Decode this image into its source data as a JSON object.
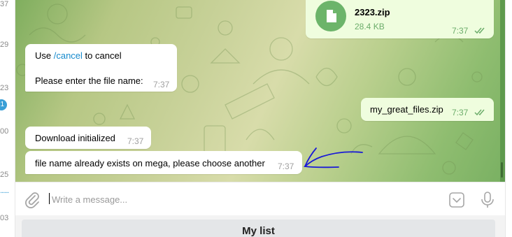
{
  "left_strip": {
    "labels": [
      "37",
      "29",
      "23",
      "00",
      "25",
      "03"
    ],
    "badge": "1",
    "dots": "......"
  },
  "messages": {
    "file": {
      "name": "2323.zip",
      "size": "28.4 KB",
      "time": "7:37"
    },
    "cancel": {
      "prefix": "Use ",
      "command": "/cancel",
      "suffix": " to cancel",
      "line2": "Please enter the file name:",
      "time": "7:37"
    },
    "outgoing_name": {
      "text": "my_great_files.zip",
      "time": "7:37"
    },
    "download": {
      "text": "Download initialized",
      "time": "7:37"
    },
    "exists": {
      "text": "file name already exists on mega, please choose another",
      "time": "7:37"
    }
  },
  "input": {
    "placeholder": "Write a message..."
  },
  "keyboard": {
    "button_label": "My list"
  },
  "icons": {
    "attach": "paperclip-icon",
    "emoji": "emoji-keyboard-icon",
    "mic": "microphone-icon",
    "file": "document-icon",
    "read": "double-check-icon"
  },
  "colors": {
    "accent": "#168acd",
    "out_bubble": "#effdde",
    "out_time": "#6cad6b",
    "annotation": "#1a1ad6"
  }
}
